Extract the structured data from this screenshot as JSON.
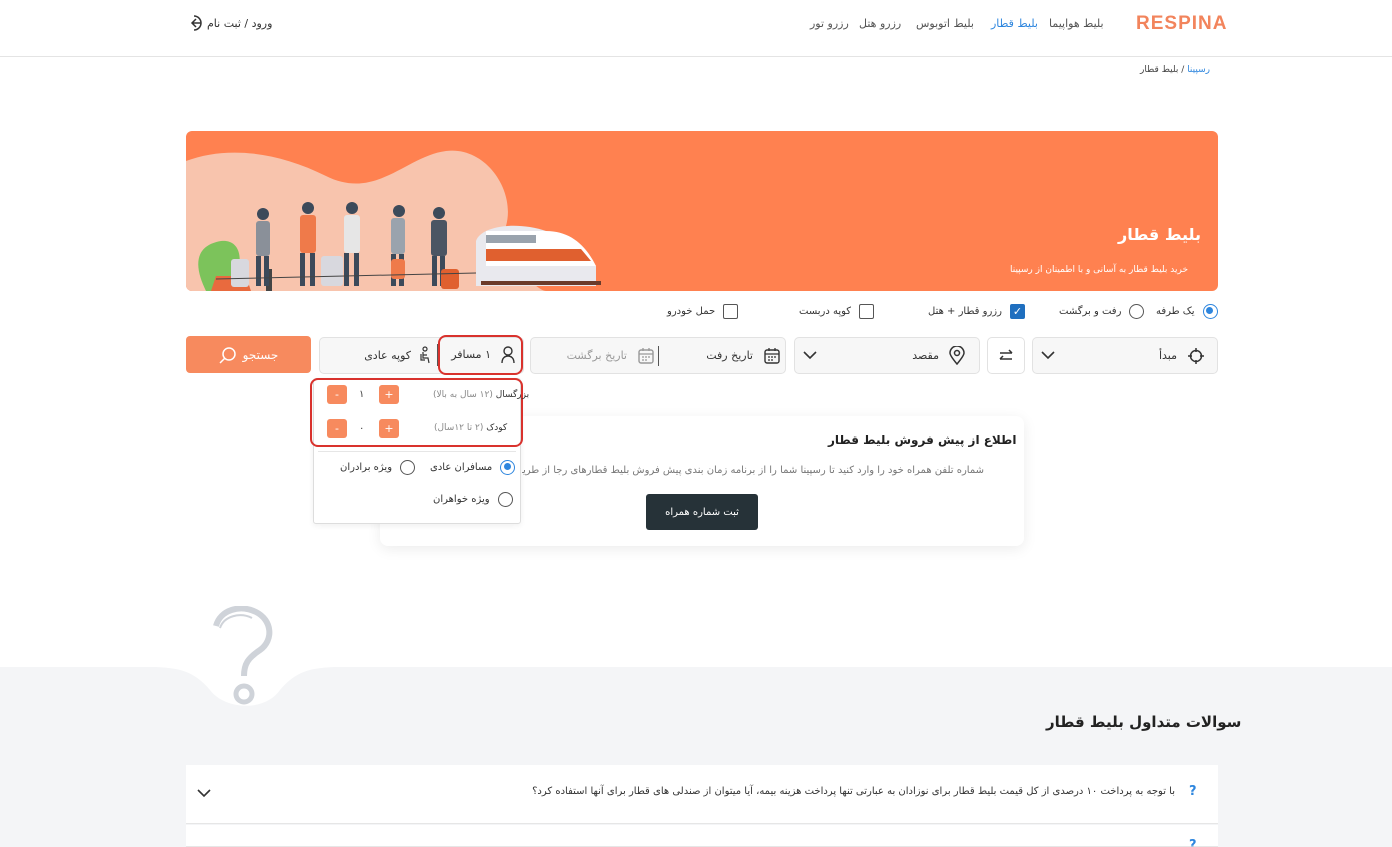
{
  "header": {
    "logo": "RESPINA",
    "nav": [
      {
        "label": "بلیط هواپیما",
        "active": false
      },
      {
        "label": "بلیط قطار",
        "active": true
      },
      {
        "label": "بلیط اتوبوس",
        "active": false
      },
      {
        "label": "رزرو هتل",
        "active": false
      },
      {
        "label": "رزرو تور",
        "active": false
      }
    ],
    "login_label": "ورود / ثبت نام"
  },
  "breadcrumb": {
    "home": "رسپینا",
    "separator": "/",
    "current": "بلیط قطار"
  },
  "banner": {
    "title": "بلیط قطار",
    "subtitle": "خرید بلیط قطار به آسانی و با اطمینان از رسپینا"
  },
  "options": {
    "one_way": {
      "label": "یک طرفه",
      "selected": true
    },
    "round_trip": {
      "label": "رفت و برگشت",
      "selected": false
    },
    "train_hotel": {
      "label": "رزرو قطار + هتل",
      "checked": true
    },
    "exclusive_coupe": {
      "label": "کوپه دربست",
      "checked": false
    },
    "car_transport": {
      "label": "حمل خودرو",
      "checked": false
    }
  },
  "search": {
    "origin_placeholder": "مبدأ",
    "destination_placeholder": "مقصد",
    "depart_placeholder": "تاریخ رفت",
    "return_placeholder": "تاریخ برگشت",
    "passengers_label": "۱ مسافر",
    "coupe_label": "کوپه عادی",
    "search_label": "جستجو"
  },
  "passengers": {
    "adult": {
      "label": "بزرگسال",
      "hint": "(۱۲ سال به بالا)",
      "count": "۱"
    },
    "child": {
      "label": "کودک",
      "hint": "(۲ تا ۱۲سال)",
      "count": "۰"
    },
    "plus": "+",
    "minus": "-",
    "types": [
      {
        "label": "مسافران عادی",
        "selected": true
      },
      {
        "label": "ویژه برادران",
        "selected": false
      },
      {
        "label": "ویژه خواهران",
        "selected": false
      }
    ]
  },
  "notice": {
    "title": "اطلاع از پیش فروش بلیط قطار",
    "text": "شماره تلفن همراه خود را وارد کنید تا رسپینا شما را از برنامه زمان بندی پیش فروش بلیط قطارهای رجا از طریق پیامک مطلع کند",
    "button": "ثبت شماره همراه"
  },
  "faq": {
    "title": "سوالات متداول بلیط قطار",
    "items": [
      {
        "question": "با توجه به پرداخت ۱۰ درصدی از کل قیمت بلیط قطار برای نوزادان به عبارتی تنها پرداخت هزینه بیمه، آیا میتوان از صندلی های قطار برای آنها استفاده کرد؟"
      }
    ]
  },
  "colors": {
    "brand": "#f2845c",
    "banner": "#ff8150",
    "accent_blue": "#2e86de",
    "highlight_red": "#d9322d",
    "dark_button": "#263238"
  }
}
